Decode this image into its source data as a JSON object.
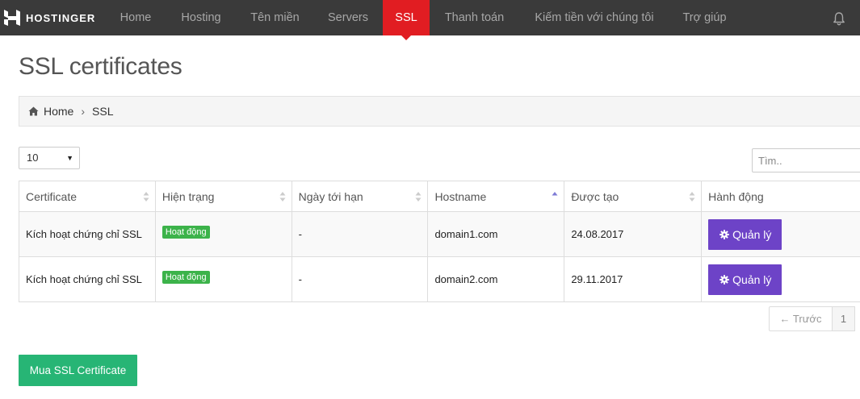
{
  "brand": {
    "name": "HOSTINGER"
  },
  "nav": {
    "items": [
      {
        "label": "Home"
      },
      {
        "label": "Hosting"
      },
      {
        "label": "Tên miền"
      },
      {
        "label": "Servers"
      },
      {
        "label": "SSL"
      },
      {
        "label": "Thanh toán"
      },
      {
        "label": "Kiếm tiền với chúng tôi"
      },
      {
        "label": "Trợ giúp"
      }
    ],
    "active": "SSL"
  },
  "page": {
    "title": "SSL certificates"
  },
  "breadcrumb": {
    "home": "Home",
    "current": "SSL"
  },
  "controls": {
    "page_length": "10",
    "search_placeholder": "Tìm.."
  },
  "table": {
    "headers": [
      "Certificate",
      "Hiện trạng",
      "Ngày tới hạn",
      "Hostname",
      "Được tạo",
      "Hành động"
    ],
    "rows": [
      {
        "certificate": "Kích hoạt chứng chỉ SSL",
        "status": "Hoạt động",
        "expiry": "-",
        "hostname": "domain1.com",
        "created": "24.08.2017",
        "action": "Quản lý"
      },
      {
        "certificate": "Kích hoạt chứng chỉ SSL",
        "status": "Hoạt động",
        "expiry": "-",
        "hostname": "domain2.com",
        "created": "29.11.2017",
        "action": "Quản lý"
      }
    ]
  },
  "pagination": {
    "prev": "← Trước",
    "page": "1"
  },
  "buy_button": "Mua SSL Certificate",
  "colors": {
    "navbar": "#3a3a3a",
    "active_nav": "#e11d22",
    "status_badge": "#3cb34a",
    "manage_button": "#6d43c7",
    "buy_button": "#27b575"
  },
  "icons": {
    "brand": "hostinger-logo-icon",
    "bell": "bell-icon",
    "home": "home-icon",
    "gear": "gear-icon",
    "sort": "sort-icon"
  }
}
